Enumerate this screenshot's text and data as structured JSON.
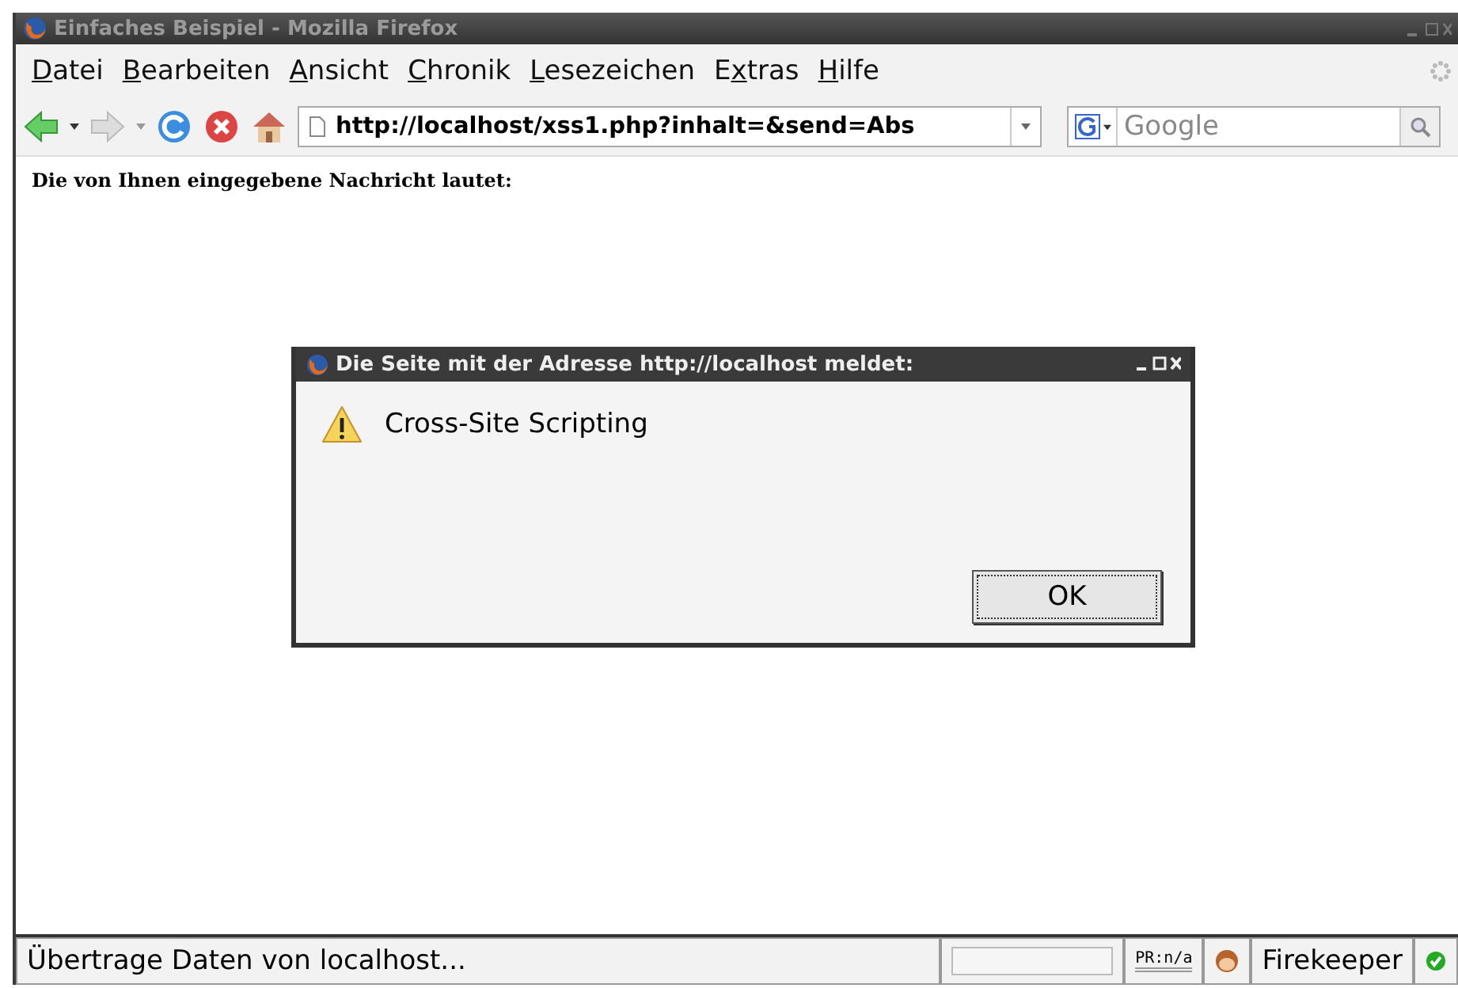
{
  "window": {
    "title": "Einfaches Beispiel - Mozilla Firefox"
  },
  "menu": [
    {
      "key": "D",
      "post": "atei"
    },
    {
      "key": "B",
      "post": "earbeiten"
    },
    {
      "key": "A",
      "post": "nsicht"
    },
    {
      "key": "C",
      "post": "hronik"
    },
    {
      "key": "L",
      "post": "esezeichen"
    },
    {
      "pre": "E",
      "key": "x",
      "post": "tras"
    },
    {
      "key": "H",
      "post": "ilfe"
    }
  ],
  "toolbar": {
    "url": "http://localhost/xss1.php?inhalt=&send=Abs",
    "search_placeholder": "Google"
  },
  "page": {
    "text": "Die von Ihnen eingegebene Nachricht lautet:"
  },
  "dialog": {
    "title": "Die Seite mit der Adresse http://localhost meldet:",
    "message": "Cross-Site Scripting",
    "button": "OK"
  },
  "status_bar": {
    "text": "Übertrage Daten von localhost...",
    "pagerank": "PR:n/a",
    "progress": {
      "level": 0
    },
    "addon": "Firekeeper"
  }
}
